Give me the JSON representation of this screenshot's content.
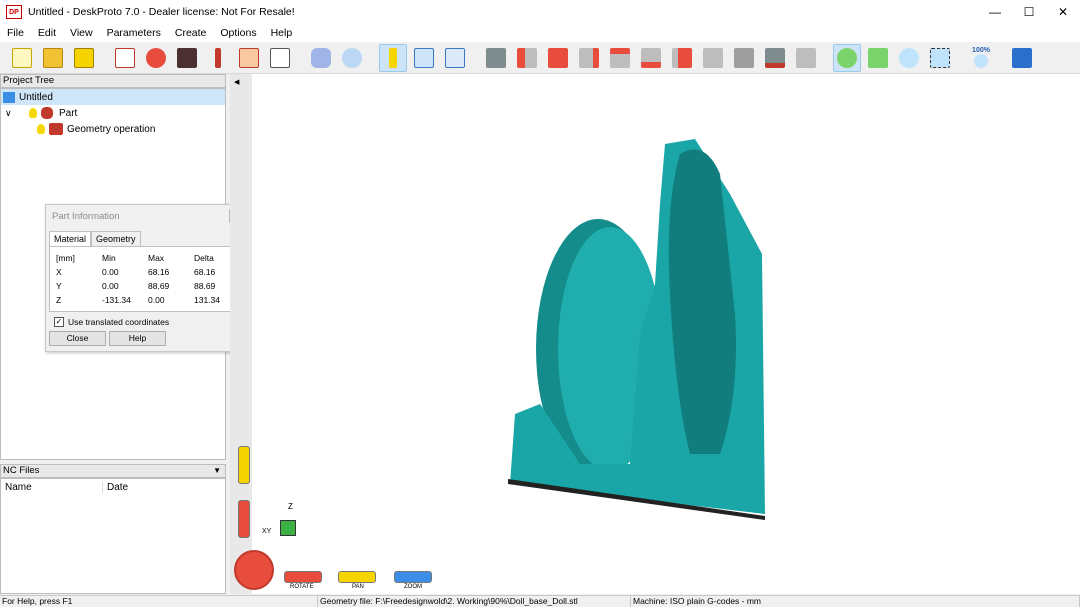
{
  "window": {
    "logo": "DP",
    "title": "Untitled - DeskProto 7.0 - Dealer license: Not For Resale!"
  },
  "menu": [
    "File",
    "Edit",
    "View",
    "Parameters",
    "Create",
    "Options",
    "Help"
  ],
  "toolbar": {
    "icons": [
      "new-project-icon",
      "open-project-icon",
      "save-project-icon",
      "load-geometry-icon",
      "part-icon",
      "vector-icon",
      "bitmap-icon",
      "operation-icon",
      "save-nc-icon",
      "show-part-icon",
      "view-toolpath-icon",
      "info-icon",
      "layout-icon",
      "preview-icon",
      "camera-icon",
      "view-front-icon",
      "view-back-icon",
      "view-left-icon",
      "view-right-icon",
      "view-top-icon",
      "view-bottom-icon",
      "view-iso-icon",
      "view-iso2-icon",
      "capture-icon",
      "print-icon",
      "rotate-icon",
      "pan-icon",
      "zoom-in-icon",
      "zoom-window-icon",
      "zoom-100-icon",
      "help-book-icon"
    ],
    "zoom_label": "100%"
  },
  "project_tree": {
    "header": "Project Tree",
    "root": "Untitled",
    "part": "Part",
    "operation": "Geometry operation"
  },
  "nc_files": {
    "header": "NC Files",
    "col_name": "Name",
    "col_date": "Date"
  },
  "part_info": {
    "title": "Part Information",
    "tabs": [
      "Material",
      "Geometry"
    ],
    "header": [
      "[mm]",
      "Min",
      "Max",
      "Delta"
    ],
    "rows": [
      [
        "X",
        "0.00",
        "68.16",
        "68.16"
      ],
      [
        "Y",
        "0.00",
        "88.69",
        "88.69"
      ],
      [
        "Z",
        "-131.34",
        "0.00",
        "131.34"
      ]
    ],
    "checkbox_label": "Use translated coordinates",
    "close": "Close",
    "help": "Help"
  },
  "viewport": {
    "controls": {
      "rotate": "ROTATE",
      "pan": "PAN",
      "zoom": "ZOOM"
    },
    "axes": {
      "z": "Z",
      "xy": "XY"
    },
    "model_color": "#1aa6a6"
  },
  "status": {
    "help": "For Help, press F1",
    "geometry": "Geometry file: F:\\Freedesignwold\\2. Working\\90%\\Doll_base_Doll.stl",
    "machine": "Machine: ISO plain G-codes - mm"
  }
}
